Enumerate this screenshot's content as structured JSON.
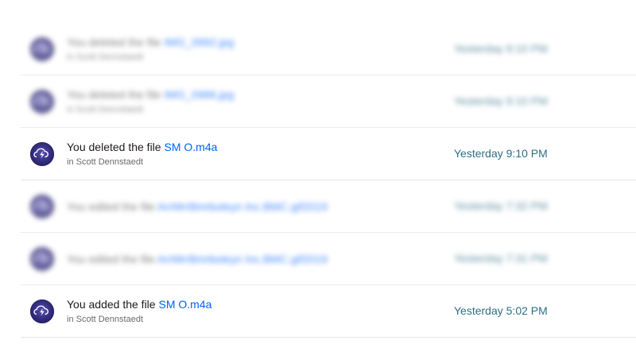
{
  "events": [
    {
      "blurred": true,
      "action": "You deleted the file",
      "file": "IMG_0992.jpg",
      "location": "in Scott Dennstaedt",
      "time": "Yesterday 9:10 PM"
    },
    {
      "blurred": true,
      "action": "You deleted the file",
      "file": "IMG_0986.jpg",
      "location": "in Scott Dennstaedt",
      "time": "Yesterday 9:10 PM"
    },
    {
      "blurred": false,
      "action": "You deleted the file",
      "file": "SM O.m4a",
      "location": "in Scott Dennstaedt",
      "time": "Yesterday 9:10 PM"
    },
    {
      "blurred": true,
      "action": "You edited the file",
      "file": "ArrMrrBmrboleyn Inc.BMC.gif2019",
      "location": "",
      "time": "Yesterday 7:32 PM"
    },
    {
      "blurred": true,
      "action": "You edited the file",
      "file": "ArrMrrBmrboleyn Inc.BMC.gif2019",
      "location": "",
      "time": "Yesterday 7:31 PM"
    },
    {
      "blurred": false,
      "action": "You added the file",
      "file": "SM O.m4a",
      "location": "in Scott Dennstaedt",
      "time": "Yesterday 5:02 PM"
    }
  ],
  "avatar_icon": "lightning-cloud-icon",
  "colors": {
    "link": "#0061fe",
    "time": "#2e6e86",
    "avatar": "#2f2a7a"
  }
}
